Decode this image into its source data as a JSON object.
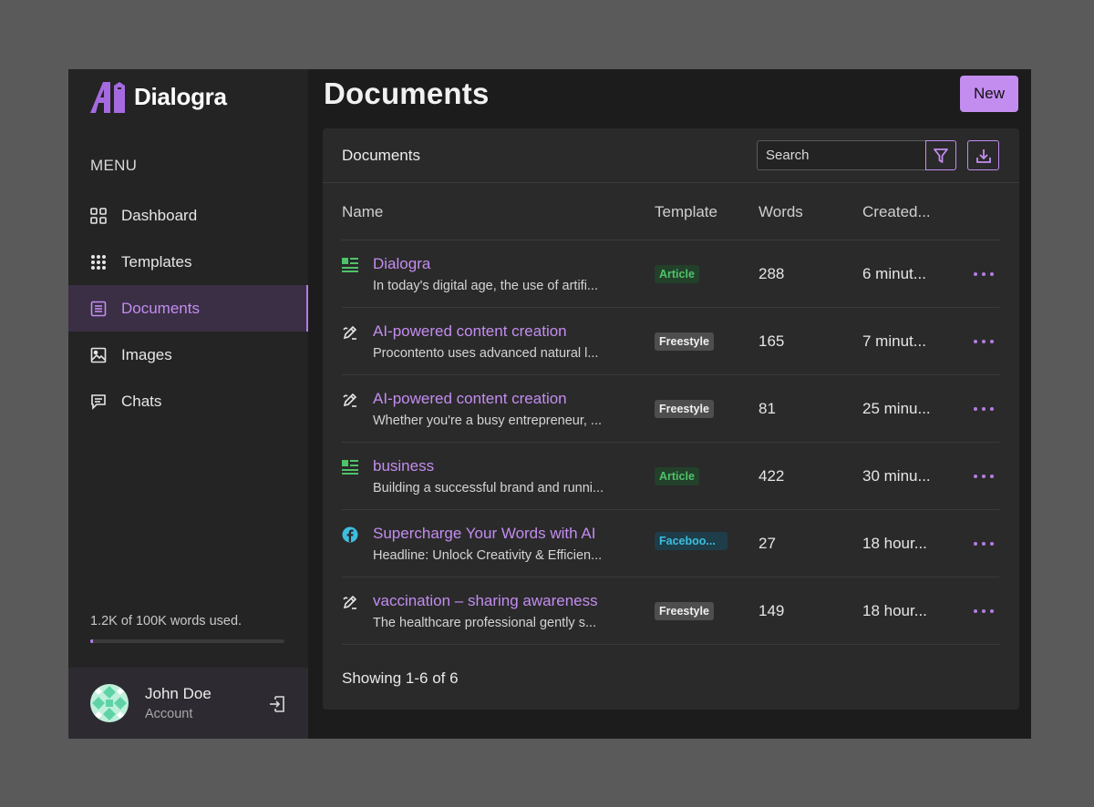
{
  "app": {
    "brand": "Dialogra",
    "accent": "#c38df0"
  },
  "sidebar": {
    "menu_label": "MENU",
    "items": [
      {
        "label": "Dashboard",
        "icon": "grid-icon"
      },
      {
        "label": "Templates",
        "icon": "dots-grid-icon"
      },
      {
        "label": "Documents",
        "icon": "document-icon",
        "active": true
      },
      {
        "label": "Images",
        "icon": "image-icon"
      },
      {
        "label": "Chats",
        "icon": "chat-icon"
      }
    ],
    "usage_text": "1.2K of 100K words used.",
    "usage_fraction": 0.012
  },
  "user": {
    "name": "John Doe",
    "subtitle": "Account"
  },
  "header": {
    "title": "Documents",
    "new_label": "New"
  },
  "card": {
    "title": "Documents",
    "search_placeholder": "Search",
    "columns": [
      "Name",
      "Template",
      "Words",
      "Created..."
    ],
    "rows": [
      {
        "icon": "article-icon",
        "title": "Dialogra",
        "desc": "In today's digital age, the use of artifi...",
        "template": "Article",
        "template_type": "article",
        "words": "288",
        "created": "6 minut..."
      },
      {
        "icon": "pencil-icon",
        "title": "AI-powered content creation",
        "desc": "Procontento uses advanced natural l...",
        "template": "Freestyle",
        "template_type": "freestyle",
        "words": "165",
        "created": "7 minut..."
      },
      {
        "icon": "pencil-icon",
        "title": "AI-powered content creation",
        "desc": "Whether you're a busy entrepreneur, ...",
        "template": "Freestyle",
        "template_type": "freestyle",
        "words": "81",
        "created": "25 minu..."
      },
      {
        "icon": "article-icon",
        "title": "business",
        "desc": "Building a successful brand and runni...",
        "template": "Article",
        "template_type": "article",
        "words": "422",
        "created": "30 minu..."
      },
      {
        "icon": "facebook-icon",
        "title": "Supercharge Your Words with AI",
        "desc": "Headline: Unlock Creativity & Efficien...",
        "template": "Faceboo...",
        "template_type": "facebook",
        "words": "27",
        "created": "18 hour..."
      },
      {
        "icon": "pencil-icon",
        "title": "vaccination – sharing awareness",
        "desc": "The healthcare professional gently s...",
        "template": "Freestyle",
        "template_type": "freestyle",
        "words": "149",
        "created": "18 hour..."
      }
    ],
    "footer": "Showing 1-6 of 6"
  }
}
